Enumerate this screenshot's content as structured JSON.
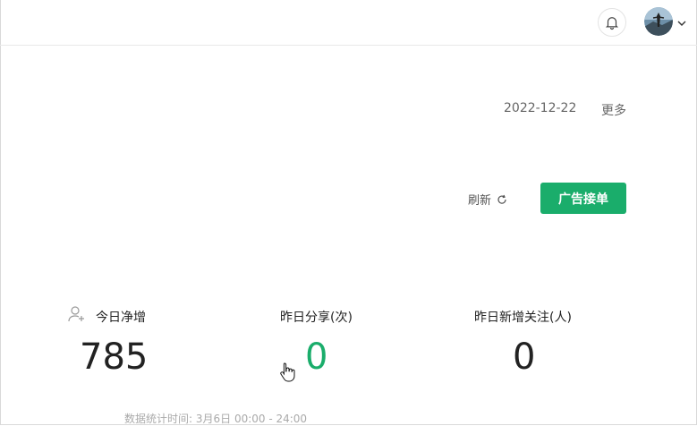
{
  "header": {
    "notification_icon": "bell-icon",
    "avatar_icon": "user-avatar",
    "dropdown_icon": "chevron-down-icon"
  },
  "summary": {
    "date": "2022-12-22",
    "more_label": "更多"
  },
  "actions": {
    "refresh_label": "刷新",
    "ad_button_label": "广告接单",
    "accent_color": "#1aad6b"
  },
  "stats": [
    {
      "label": "今日净增",
      "value": "785",
      "icon": "user-add-icon",
      "color": "#222222"
    },
    {
      "label": "昨日分享(次)",
      "value": "0",
      "color": "#1aad6b"
    },
    {
      "label": "昨日新增关注(人)",
      "value": "0",
      "color": "#222222"
    }
  ],
  "footer": {
    "note": "数据统计时间: 3月6日 00:00 - 24:00"
  }
}
